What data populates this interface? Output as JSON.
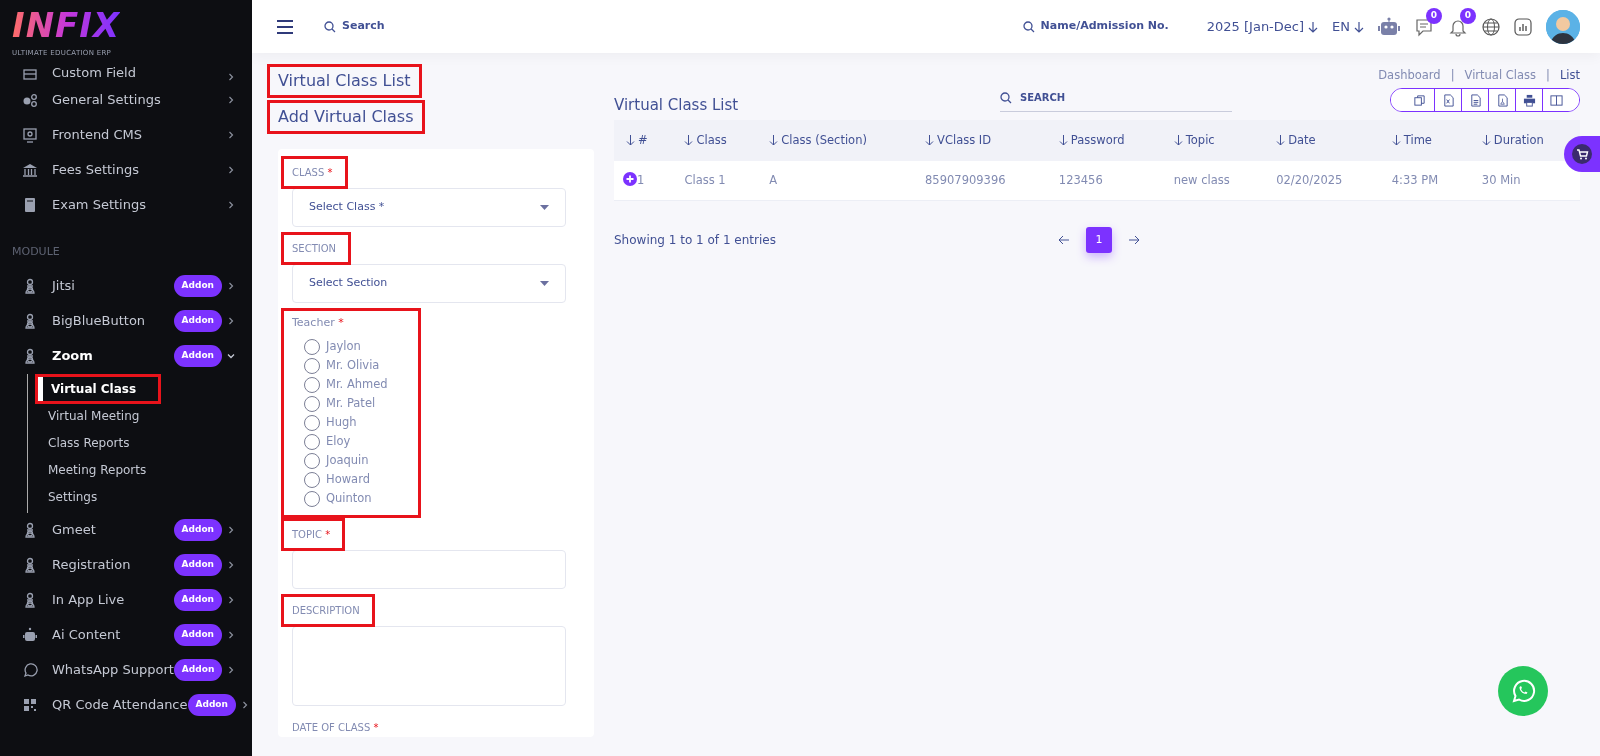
{
  "brand": {
    "logo": "INFIX",
    "tagline": "ULTIMATE EDUCATION ERP"
  },
  "sidebar": {
    "items": [
      {
        "label": "Custom Field",
        "kind": "field"
      },
      {
        "label": "General Settings",
        "kind": "gears"
      },
      {
        "label": "Frontend CMS",
        "kind": "monitor"
      },
      {
        "label": "Fees Settings",
        "kind": "bank"
      },
      {
        "label": "Exam Settings",
        "kind": "book"
      }
    ],
    "section": "MODULE",
    "modules": [
      {
        "label": "Jitsi",
        "kind": "person",
        "badge": "Addon",
        "expanded": false
      },
      {
        "label": "BigBlueButton",
        "kind": "person",
        "badge": "Addon",
        "expanded": false
      },
      {
        "label": "Zoom",
        "kind": "person",
        "badge": "Addon",
        "expanded": true,
        "children": [
          {
            "label": "Virtual Class",
            "selected": true,
            "highlighted": true
          },
          {
            "label": "Virtual Meeting",
            "selected": false,
            "highlighted": false
          },
          {
            "label": "Class Reports",
            "selected": false,
            "highlighted": false
          },
          {
            "label": "Meeting Reports",
            "selected": false,
            "highlighted": false
          },
          {
            "label": "Settings",
            "selected": false,
            "highlighted": false
          }
        ]
      },
      {
        "label": "Gmeet",
        "kind": "person",
        "badge": "Addon",
        "expanded": false
      },
      {
        "label": "Registration",
        "kind": "person",
        "badge": "Addon",
        "expanded": false
      },
      {
        "label": "In App Live",
        "kind": "person",
        "badge": "Addon",
        "expanded": false
      },
      {
        "label": "Ai Content",
        "kind": "robot",
        "badge": "Addon",
        "expanded": false
      },
      {
        "label": "WhatsApp Support",
        "kind": "chat",
        "badge": "Addon",
        "expanded": false
      },
      {
        "label": "QR Code Attendance",
        "kind": "qr",
        "badge": "Addon",
        "expanded": false
      }
    ]
  },
  "topbar": {
    "search": "Search",
    "student_search": "Name/Admission No.",
    "session": "2025 [Jan-Dec]",
    "language": "EN",
    "messages_count": "0",
    "notifications_count": "0"
  },
  "page_title": {
    "text": "Virtual Class List",
    "highlighted": true
  },
  "breadcrumb": {
    "separator": "|",
    "items": [
      {
        "label": "Dashboard",
        "current": false
      },
      {
        "label": "Virtual Class",
        "current": false
      },
      {
        "label": "List",
        "current": true
      }
    ]
  },
  "form": {
    "title": "Add Virtual Class",
    "highlighted": true,
    "fields": [
      {
        "kind": "select",
        "label": "CLASS",
        "required_mark": "*",
        "highlighted": true,
        "placeholder": "Select Class *"
      },
      {
        "kind": "select",
        "label": "SECTION",
        "highlighted": true,
        "placeholder": "Select Section"
      },
      {
        "kind": "radio",
        "label": "Teacher",
        "required_mark": "*",
        "highlighted": true,
        "options": [
          {
            "label": "Jaylon",
            "selected": false
          },
          {
            "label": "Mr. Olivia",
            "selected": false
          },
          {
            "label": "Mr. Ahmed",
            "selected": false
          },
          {
            "label": "Mr. Patel",
            "selected": false
          },
          {
            "label": "Hugh",
            "selected": false
          },
          {
            "label": "Eloy",
            "selected": false
          },
          {
            "label": "Joaquin",
            "selected": false
          },
          {
            "label": "Howard",
            "selected": false
          },
          {
            "label": "Quinton",
            "selected": false
          }
        ]
      },
      {
        "kind": "text",
        "label": "TOPIC",
        "required_mark": "*",
        "highlighted": true
      },
      {
        "kind": "textarea",
        "label": "DESCRIPTION",
        "highlighted": true
      },
      {
        "kind": "date",
        "label": "DATE OF CLASS",
        "required_mark": "*",
        "highlighted": false
      }
    ]
  },
  "table": {
    "title": "Virtual Class List",
    "search_placeholder": "SEARCH",
    "export_buttons": [
      {
        "kind": "copy"
      },
      {
        "kind": "excel"
      },
      {
        "kind": "csv"
      },
      {
        "kind": "pdf"
      },
      {
        "kind": "print"
      },
      {
        "kind": "columns"
      }
    ],
    "columns": [
      "#",
      "Class",
      "Class (Section)",
      "VClass ID",
      "Password",
      "Topic",
      "Date",
      "Time",
      "Duration"
    ],
    "rows": [
      [
        "1",
        "Class 1",
        "A",
        "85907909396",
        "123456",
        "new class",
        "02/20/2025",
        "4:33 PM",
        "30 Min"
      ]
    ],
    "info": "Showing 1 to 1 of 1 entries",
    "pages": [
      {
        "label": "1",
        "selected": true
      }
    ]
  }
}
